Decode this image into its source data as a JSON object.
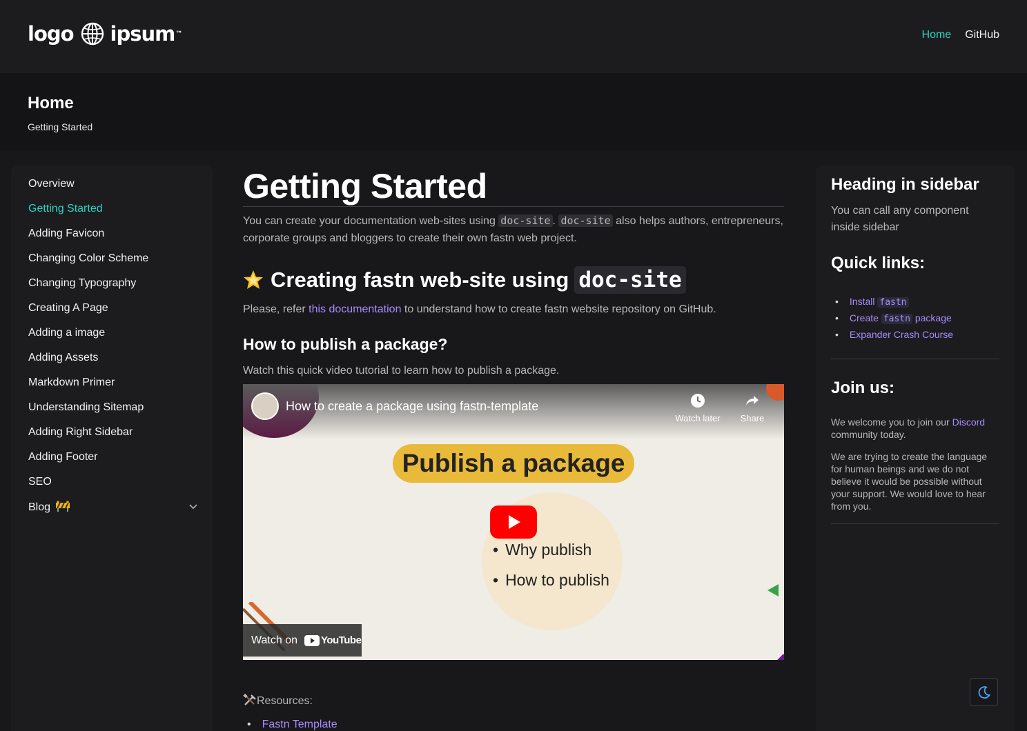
{
  "header": {
    "logo_left": "logo",
    "logo_right": "ipsum",
    "logo_tm": "™",
    "nav": [
      {
        "label": "Home",
        "active": true
      },
      {
        "label": "GitHub",
        "active": false
      }
    ],
    "accent_color": "#2dd4bf"
  },
  "page_header": {
    "title": "Home",
    "breadcrumb": "Getting Started"
  },
  "sidebar": {
    "items": [
      {
        "label": "Overview"
      },
      {
        "label": "Getting Started",
        "active": true
      },
      {
        "label": "Adding Favicon"
      },
      {
        "label": "Changing Color Scheme"
      },
      {
        "label": "Changing Typography"
      },
      {
        "label": "Creating A Page"
      },
      {
        "label": "Adding a image"
      },
      {
        "label": "Adding Assets"
      },
      {
        "label": "Markdown Primer"
      },
      {
        "label": "Understanding Sitemap"
      },
      {
        "label": "Adding Right Sidebar"
      },
      {
        "label": "Adding Footer"
      },
      {
        "label": "SEO"
      },
      {
        "label": "Blog",
        "icon": "construction-barrier-icon",
        "expandable": true
      }
    ]
  },
  "main": {
    "title": "Getting Started",
    "intro_pre": "You can create your documentation web-sites using ",
    "intro_code1": "doc-site",
    "intro_mid": ". ",
    "intro_code2": "doc-site",
    "intro_post": " also helps authors, entrepreneurs, corporate groups and bloggers to create their own fastn web project.",
    "section1_title": "Creating fastn web-site using",
    "section1_code": "doc-site",
    "section1_icon": "star-icon",
    "refer_pre": "Please, refer ",
    "refer_link": "this documentation",
    "refer_post": " to understand how to create fastn website repository on GitHub.",
    "section2_title": "How to publish a package?",
    "section2_text": "Watch this quick video tutorial to learn how to publish a package.",
    "video": {
      "title": "How to create a package using fastn-template",
      "watch_later": "Watch later",
      "share": "Share",
      "thumbnail_heading": "Publish a package",
      "bullets": [
        "Why publish",
        "How to publish"
      ],
      "watch_on": "Watch on",
      "youtube": "YouTube"
    },
    "resources_label": "Resources:",
    "resources": [
      "Fastn Template"
    ],
    "link_color": "#a78bfa"
  },
  "right_sidebar": {
    "heading": "Heading in sidebar",
    "text": "You can call any component inside sidebar",
    "quick_title": "Quick links:",
    "quick_links": [
      {
        "pre": "Install ",
        "code": "fastn",
        "post": ""
      },
      {
        "pre": "Create ",
        "code": "fastn",
        "post": " package"
      },
      {
        "pre": "Expander Crash Course",
        "code": "",
        "post": ""
      }
    ],
    "join_title": "Join us:",
    "join_p1_pre": "We welcome you to join our ",
    "join_p1_link": "Discord",
    "join_p1_post": " community today.",
    "join_p2": "We are trying to create the language for human beings and we do not believe it would be possible without your support. We would love to hear from you."
  },
  "theme_toggle": {
    "icon": "moon-icon"
  }
}
